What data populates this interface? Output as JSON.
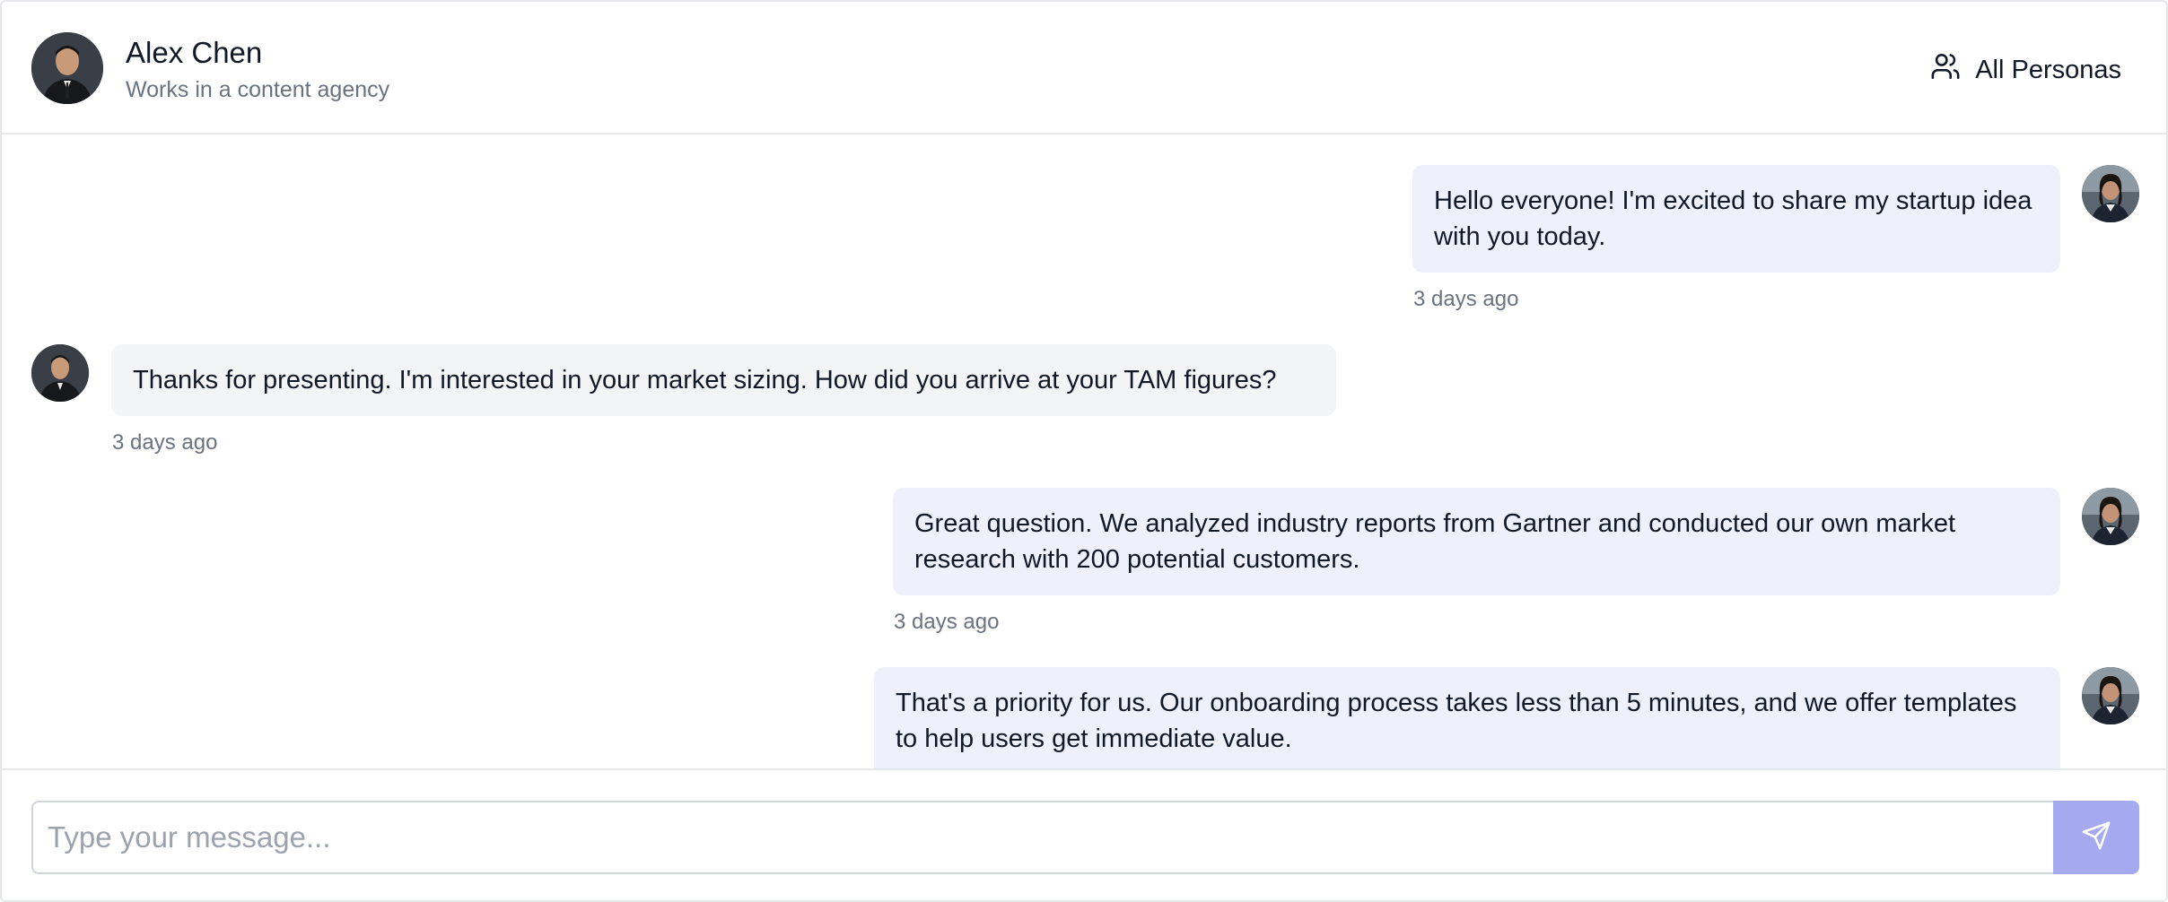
{
  "persona": {
    "name": "Alex Chen",
    "role": "Works in a content agency"
  },
  "header": {
    "all_personas_label": "All Personas"
  },
  "messages": [
    {
      "from": "user",
      "text": "Hello everyone! I'm excited to share my startup idea with you today.",
      "time": "3 days ago"
    },
    {
      "from": "persona",
      "text": "Thanks for presenting. I'm interested in your market sizing. How did you arrive at your TAM figures?",
      "time": "3 days ago"
    },
    {
      "from": "user",
      "text": "Great question. We analyzed industry reports from Gartner and conducted our own market research with 200 potential customers.",
      "time": "3 days ago"
    },
    {
      "from": "user",
      "text": "That's a priority for us. Our onboarding process takes less than 5 minutes, and we offer templates to help users get immediate value.",
      "time": ""
    }
  ],
  "composer": {
    "placeholder": "Type your message..."
  },
  "icons": {
    "personas": "users-icon",
    "send": "send-icon"
  },
  "colors": {
    "accent": "#a5a9f0",
    "user_bubble": "#eef0fc",
    "persona_bubble": "#f3f4f6"
  }
}
